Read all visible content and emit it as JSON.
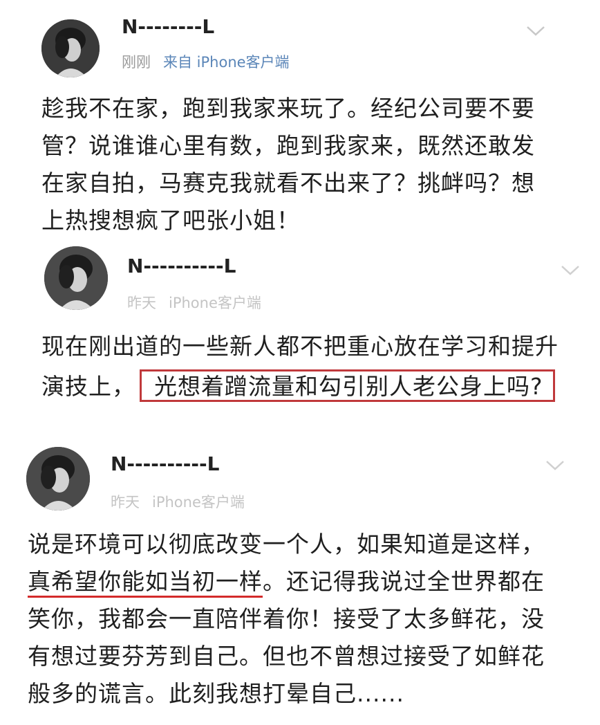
{
  "posts": [
    {
      "username": "N--------L",
      "time": "刚刚",
      "source": "来自 iPhone客户端",
      "lines": [
        "趁我不在家，跑到我家来玩了。经纪公司要不要",
        "管？说谁谁心里有数，跑到我家来，既然还敢发",
        "在家自拍，马赛克我就看不出来了？挑衅吗？想",
        "上热搜想疯了吧张小姐！"
      ]
    },
    {
      "username": "N----------L",
      "time": "昨天",
      "source": "iPhone客户端",
      "lines": [
        "现在刚出道的一些新人都不把重心放在学习和提升"
      ],
      "line2_prefix": "演技上，",
      "line2_boxed": "光想着蹭流量和勾引别人老公身上吗?"
    },
    {
      "username": "N----------L",
      "time": "昨天",
      "source": "iPhone客户端",
      "line1": "说是环境可以彻底改变一个人，如果知道是这样，",
      "line2_underlined": "真希望你能如当初一样",
      "line2_rest": "。还记得我说过全世界都在",
      "lines_after": [
        "笑你，我都会一直陪伴着你！接受了太多鲜花，没",
        "有想过要芬芳到自己。但也不曾想过接受了如鲜花",
        "般多的谎言。此刻我想打晕自己......"
      ]
    }
  ],
  "colors": {
    "highlight_box": "#c0393b",
    "underline": "#d42a2a",
    "source_blue": "#5b86b8",
    "muted": "#9a9a9a"
  },
  "icons": {
    "avatar": "avatar-photo",
    "expand": "chevron-down-icon"
  }
}
